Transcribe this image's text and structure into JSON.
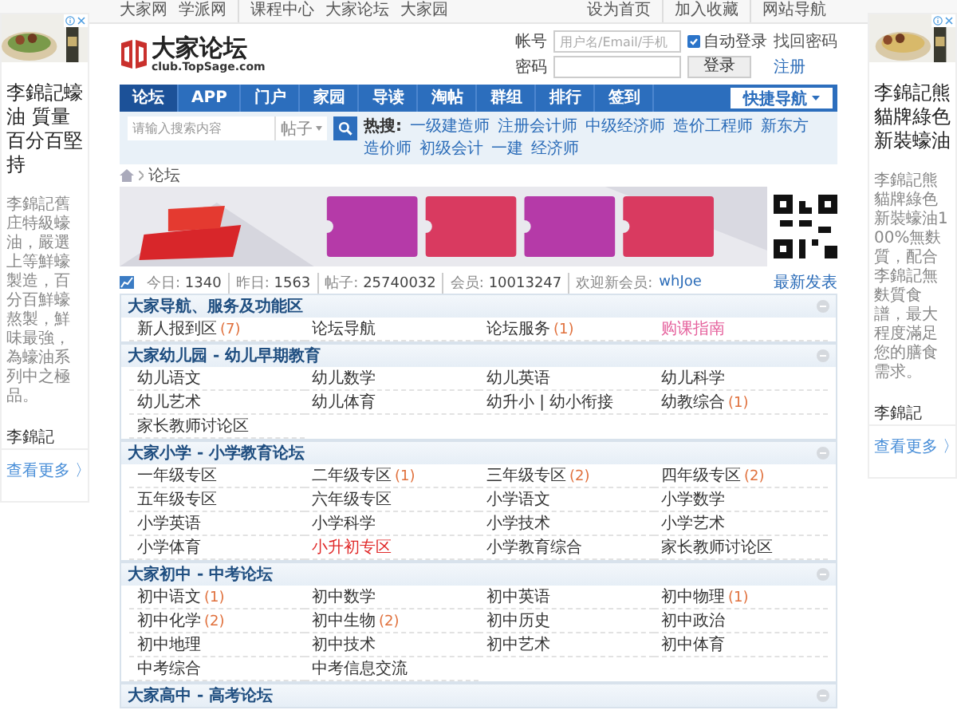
{
  "top_bar": {
    "left_links": [
      "大家网",
      "学派网",
      "课程中心",
      "大家论坛",
      "大家园"
    ],
    "right_links": [
      "设为首页",
      "加入收藏",
      "网站导航"
    ]
  },
  "logo": {
    "name": "大家论坛",
    "domain": "club.TopSage.com"
  },
  "login": {
    "account_label": "帐号",
    "account_placeholder": "用户名/Email/手机",
    "auto_login": {
      "label": "自动登录",
      "checked": true
    },
    "forgot": "找回密码",
    "password_label": "密码",
    "login_button": "登录",
    "register": "注册"
  },
  "nav": {
    "tabs": [
      {
        "label": "论坛",
        "selected": true
      },
      {
        "label": "APP",
        "selected": false
      },
      {
        "label": "门户",
        "selected": false
      },
      {
        "label": "家园",
        "selected": false
      },
      {
        "label": "导读",
        "selected": false
      },
      {
        "label": "淘帖",
        "selected": false
      },
      {
        "label": "群组",
        "selected": false
      },
      {
        "label": "排行",
        "selected": false
      },
      {
        "label": "签到",
        "selected": false
      }
    ],
    "quick_nav": "快捷导航"
  },
  "search": {
    "placeholder": "请输入搜索内容",
    "scope": "帖子",
    "hot_label": "热搜:",
    "hot_terms": [
      "一级建造师",
      "注册会计师",
      "中级经济师",
      "造价工程师",
      "新东方",
      "造价师",
      "初级会计",
      "一建",
      "经济师"
    ]
  },
  "breadcrumb": [
    "论坛"
  ],
  "stats": {
    "items": [
      {
        "label": "今日:",
        "value": "1340"
      },
      {
        "label": "昨日:",
        "value": "1563"
      },
      {
        "label": "帖子:",
        "value": "25740032"
      },
      {
        "label": "会员:",
        "value": "10013247"
      }
    ],
    "new_member_label": "欢迎新会员:",
    "new_member": "whJoe",
    "latest": "最新发表"
  },
  "sections": [
    {
      "title": "大家导航、服务及功能区",
      "forums": [
        {
          "name": "新人报到区",
          "count": "(7)",
          "color": "#333333"
        },
        {
          "name": "论坛导航",
          "color": "#333333"
        },
        {
          "name": "论坛服务",
          "count": "(1)",
          "color": "#333333"
        },
        {
          "name": "购课指南",
          "color": "#e5609c"
        }
      ]
    },
    {
      "title": "大家幼儿园 - 幼儿早期教育",
      "forums": [
        {
          "name": "幼儿语文",
          "color": "#333333"
        },
        {
          "name": "幼儿数学",
          "color": "#333333"
        },
        {
          "name": "幼儿英语",
          "color": "#333333"
        },
        {
          "name": "幼儿科学",
          "color": "#333333"
        },
        {
          "name": "幼儿艺术",
          "color": "#333333"
        },
        {
          "name": "幼儿体育",
          "color": "#333333"
        },
        {
          "name": "幼升小 | 幼小衔接",
          "color": "#333333"
        },
        {
          "name": "幼教综合",
          "count": "(1)",
          "color": "#333333"
        },
        {
          "name": "家长教师讨论区",
          "color": "#333333"
        }
      ]
    },
    {
      "title": "大家小学 - 小学教育论坛",
      "forums": [
        {
          "name": "一年级专区",
          "color": "#333333"
        },
        {
          "name": "二年级专区",
          "count": "(1)",
          "color": "#333333"
        },
        {
          "name": "三年级专区",
          "count": "(2)",
          "color": "#333333"
        },
        {
          "name": "四年级专区",
          "count": "(2)",
          "color": "#333333"
        },
        {
          "name": "五年级专区",
          "color": "#333333"
        },
        {
          "name": "六年级专区",
          "color": "#333333"
        },
        {
          "name": "小学语文",
          "color": "#333333"
        },
        {
          "name": "小学数学",
          "color": "#333333"
        },
        {
          "name": "小学英语",
          "color": "#333333"
        },
        {
          "name": "小学科学",
          "color": "#333333"
        },
        {
          "name": "小学技术",
          "color": "#333333"
        },
        {
          "name": "小学艺术",
          "color": "#333333"
        },
        {
          "name": "小学体育",
          "color": "#333333"
        },
        {
          "name": "小升初专区",
          "color": "#e02828"
        },
        {
          "name": "小学教育综合",
          "color": "#333333"
        },
        {
          "name": "家长教师讨论区",
          "color": "#333333"
        }
      ]
    },
    {
      "title": "大家初中 - 中考论坛",
      "forums": [
        {
          "name": "初中语文",
          "count": "(1)",
          "color": "#333333"
        },
        {
          "name": "初中数学",
          "color": "#333333"
        },
        {
          "name": "初中英语",
          "color": "#333333"
        },
        {
          "name": "初中物理",
          "count": "(1)",
          "color": "#333333"
        },
        {
          "name": "初中化学",
          "count": "(2)",
          "color": "#333333"
        },
        {
          "name": "初中生物",
          "count": "(2)",
          "color": "#333333"
        },
        {
          "name": "初中历史",
          "color": "#333333"
        },
        {
          "name": "初中政治",
          "color": "#333333"
        },
        {
          "name": "初中地理",
          "color": "#333333"
        },
        {
          "name": "初中技术",
          "color": "#333333"
        },
        {
          "name": "初中艺术",
          "color": "#333333"
        },
        {
          "name": "初中体育",
          "color": "#333333"
        },
        {
          "name": "中考综合",
          "color": "#333333"
        },
        {
          "name": "中考信息交流",
          "color": "#333333"
        }
      ]
    },
    {
      "title": "大家高中 - 高考论坛"
    }
  ],
  "ads": [
    {
      "title": "李錦記蠔油 質量百分百堅持",
      "body": "李錦記舊庄特級蠔油，嚴選上等鮮蠔製造，百分百鮮蠔熬製，鮮味最強，為蠔油系列中之極品。",
      "brand": "李錦記",
      "more": "查看更多 〉"
    },
    {
      "title": "李錦記熊貓牌綠色新裝蠔油",
      "body": "李錦記熊貓牌綠色新裝蠔油100%無麩質，配合李錦記無麩質食譜，最大程度滿足您的膳食需求。",
      "brand": "李錦記",
      "more": "查看更多 〉"
    }
  ]
}
